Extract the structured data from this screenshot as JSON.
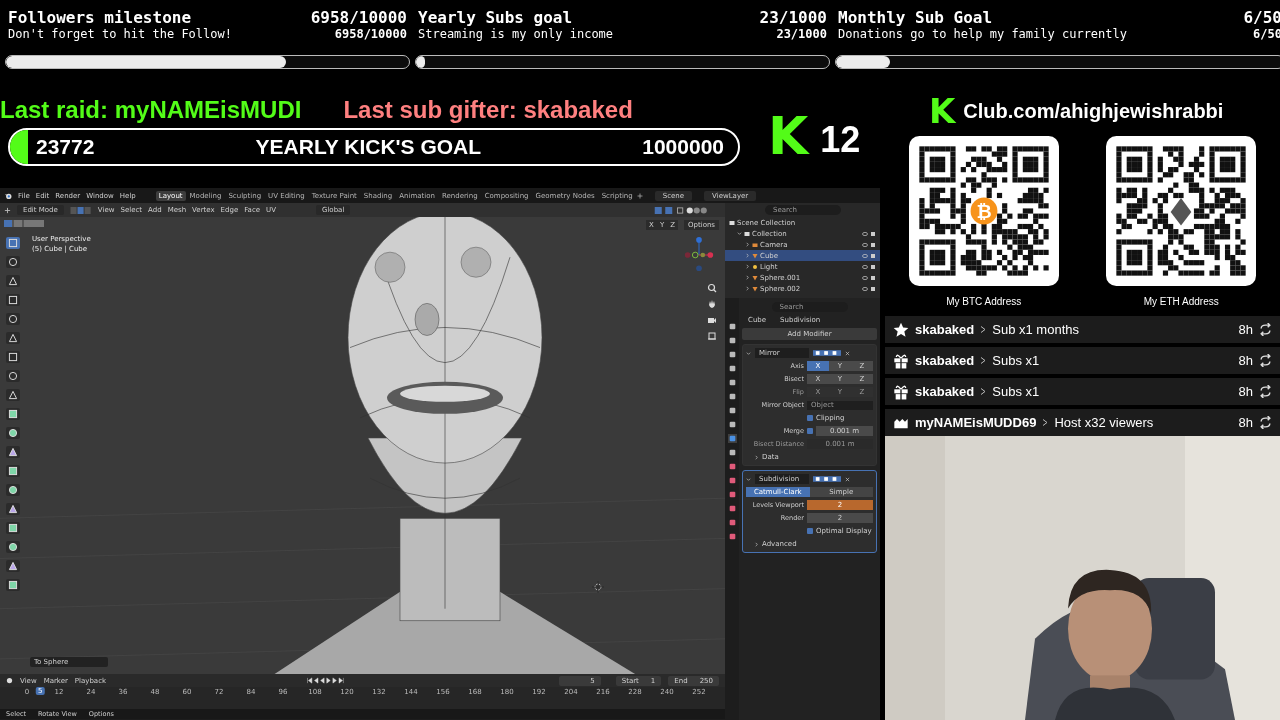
{
  "goals": [
    {
      "title": "Followers milestone",
      "count": "6958/10000",
      "subtitle": "Don't forget to hit the Follow!",
      "count_small": "6958/10000",
      "level": 0.6958
    },
    {
      "title": "Yearly Subs goal",
      "count": "23/1000",
      "subtitle": "Streaming is my only income",
      "count_small": "23/1000",
      "level": 0.023
    },
    {
      "title": "Monthly Sub Goal",
      "count": "6/50",
      "subtitle": "Donations go to help my family currently",
      "count_small": "6/50",
      "level": 0.12
    }
  ],
  "last_raid": "Last raid: myNAMEisMUDI",
  "last_sub_gifter": "Last sub gifter: skabaked",
  "kick_goal": {
    "current": "23772",
    "title": "YEARLY KICK'S GOAL",
    "target": "1000000",
    "level": 0.025
  },
  "kick_count": {
    "logo": "K",
    "count": "12"
  },
  "club": {
    "logo": "K",
    "url": "Club.com/ahighjewishrabbi"
  },
  "qr_codes": [
    {
      "label": "My BTC Address",
      "coin": {
        "kind": "btc",
        "symbol": "₿"
      }
    },
    {
      "label": "My ETH Address",
      "coin": {
        "kind": "eth"
      }
    }
  ],
  "events": [
    {
      "kind": "star",
      "user": "skabaked",
      "action": "Sub x1 months",
      "time": "8h"
    },
    {
      "kind": "gift",
      "user": "skabaked",
      "action": "Subs x1",
      "time": "8h"
    },
    {
      "kind": "gift",
      "user": "skabaked",
      "action": "Subs x1",
      "time": "8h"
    },
    {
      "kind": "host",
      "user": "myNAMEisMUDD69",
      "action": "Host x32 viewers",
      "time": "8h"
    }
  ],
  "blender": {
    "menu": [
      "File",
      "Edit",
      "Render",
      "Window",
      "Help"
    ],
    "workspaces": [
      {
        "label": "Layout",
        "selected": true
      },
      {
        "label": "Modeling",
        "selected": false
      },
      {
        "label": "Sculpting",
        "selected": false
      },
      {
        "label": "UV Editing",
        "selected": false
      },
      {
        "label": "Texture Paint",
        "selected": false
      },
      {
        "label": "Shading",
        "selected": false
      },
      {
        "label": "Animation",
        "selected": false
      },
      {
        "label": "Rendering",
        "selected": false
      },
      {
        "label": "Compositing",
        "selected": false
      },
      {
        "label": "Geometry Nodes",
        "selected": false
      },
      {
        "label": "Scripting",
        "selected": false
      }
    ],
    "scene": "Scene",
    "view_layer": "ViewLayer",
    "header": {
      "mode": "Edit Mode",
      "menus": [
        "View",
        "Select",
        "Add",
        "Mesh",
        "Vertex",
        "Edge",
        "Face",
        "UV"
      ],
      "orientation": "Global",
      "axes": [
        "X",
        "Y",
        "Z"
      ],
      "options": "Options"
    },
    "viewport": {
      "title": "User Perspective",
      "subtitle": "(5) Cube | Cube",
      "last_operation": "To Sphere"
    },
    "outliner": {
      "search_placeholder": "Search",
      "items": [
        {
          "label": "Scene Collection",
          "kind": "scene",
          "selected": false,
          "children": [
            {
              "label": "Collection",
              "kind": "collection",
              "selected": false,
              "expanded": true,
              "children": [
                {
                  "label": "Camera",
                  "kind": "camera",
                  "selected": false,
                  "expanded": false
                },
                {
                  "label": "Cube",
                  "kind": "mesh",
                  "selected": true,
                  "expanded": false
                },
                {
                  "label": "Light",
                  "kind": "light",
                  "selected": false,
                  "expanded": false
                },
                {
                  "label": "Sphere.001",
                  "kind": "mesh",
                  "selected": false,
                  "expanded": false
                },
                {
                  "label": "Sphere.002",
                  "kind": "mesh",
                  "selected": false,
                  "expanded": false
                }
              ]
            }
          ]
        }
      ]
    },
    "properties": {
      "search_placeholder": "Search",
      "breadcrumb": [
        "Cube",
        "Subdivision"
      ],
      "add_modifier": "Add Modifier",
      "modifiers": [
        {
          "name": "Mirror",
          "rows": [
            {
              "kind": "toggles",
              "label": "Axis",
              "disabled": false,
              "options": [
                {
                  "label": "X",
                  "selected": true
                },
                {
                  "label": "Y",
                  "selected": false
                },
                {
                  "label": "Z",
                  "selected": false
                }
              ]
            },
            {
              "kind": "toggles",
              "label": "Bisect",
              "disabled": false,
              "options": [
                {
                  "label": "X",
                  "selected": false
                },
                {
                  "label": "Y",
                  "selected": false
                },
                {
                  "label": "Z",
                  "selected": false
                }
              ]
            },
            {
              "kind": "toggles",
              "label": "Flip",
              "disabled": true,
              "options": [
                {
                  "label": "X",
                  "selected": false
                },
                {
                  "label": "Y",
                  "selected": false
                },
                {
                  "label": "Z",
                  "selected": false
                }
              ]
            },
            {
              "kind": "field",
              "label": "Mirror Object",
              "placeholder": "Object"
            },
            {
              "kind": "checkbox",
              "label": "Clipping",
              "checked": true
            },
            {
              "kind": "checkvalue",
              "label": "Merge",
              "checked": true,
              "value": "0.001 m"
            },
            {
              "kind": "value",
              "label": "Bisect Distance",
              "value": "0.001 m",
              "disabled": true
            },
            {
              "kind": "subpanel",
              "label": "Data",
              "expanded": false
            }
          ]
        },
        {
          "name": "Subdivision",
          "rows": [
            {
              "kind": "tabs",
              "options": [
                {
                  "label": "Catmull-Clark",
                  "selected": true
                },
                {
                  "label": "Simple",
                  "selected": false
                }
              ]
            },
            {
              "kind": "value",
              "label": "Levels Viewport",
              "value": "2",
              "disabled": false,
              "animated": true
            },
            {
              "kind": "value",
              "label": "Render",
              "value": "2",
              "disabled": false,
              "animated": false
            },
            {
              "kind": "checkbox",
              "label": "Optimal Display",
              "checked": true
            },
            {
              "kind": "subpanel",
              "label": "Advanced",
              "expanded": false
            }
          ]
        }
      ]
    },
    "timeline": {
      "menus": [
        "View",
        "Marker",
        "Playback"
      ],
      "current_frame": "5",
      "playhead_frame": "5",
      "start_label": "Start",
      "start": "1",
      "end_label": "End",
      "end": "250",
      "frames": [
        "0",
        "12",
        "24",
        "36",
        "48",
        "60",
        "72",
        "84",
        "96",
        "108",
        "120",
        "132",
        "144",
        "156",
        "168",
        "180",
        "192",
        "204",
        "216",
        "228",
        "240",
        "252"
      ]
    },
    "status": [
      "Select",
      "Rotate View",
      "Options"
    ]
  }
}
